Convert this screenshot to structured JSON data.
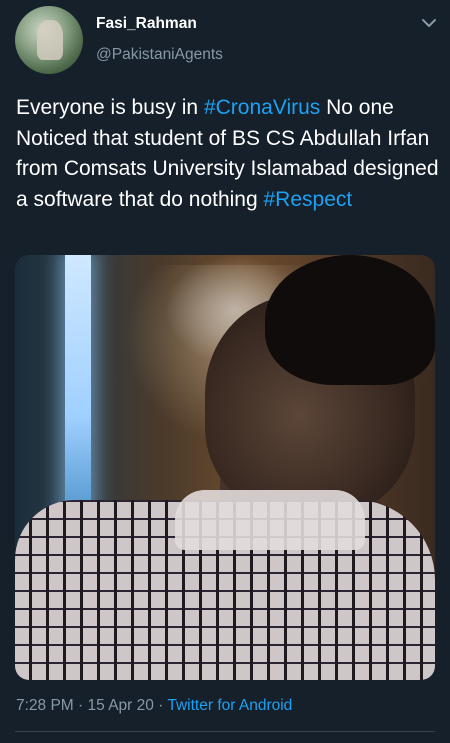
{
  "author": {
    "display_name": "Fasi_Rahman",
    "handle": "@PakistaniAgents"
  },
  "tweet": {
    "line1_before": "Everyone is busy in ",
    "hashtag1": "#CronaVirus",
    "line1_after": " No one",
    "body_rest": " Noticed that student of BS CS  Abdullah Irfan from Comsats University Islamabad designed a software that do nothing ",
    "hashtag2": "#Respect"
  },
  "meta": {
    "time": "7:28 PM",
    "sep1": " · ",
    "date": "15 Apr 20",
    "sep2": " · ",
    "source": "Twitter for Android"
  },
  "icons": {
    "caret": "chevron-down-icon"
  },
  "colors": {
    "background": "#15202b",
    "link": "#1da1f2",
    "secondary_text": "#8899a6"
  }
}
